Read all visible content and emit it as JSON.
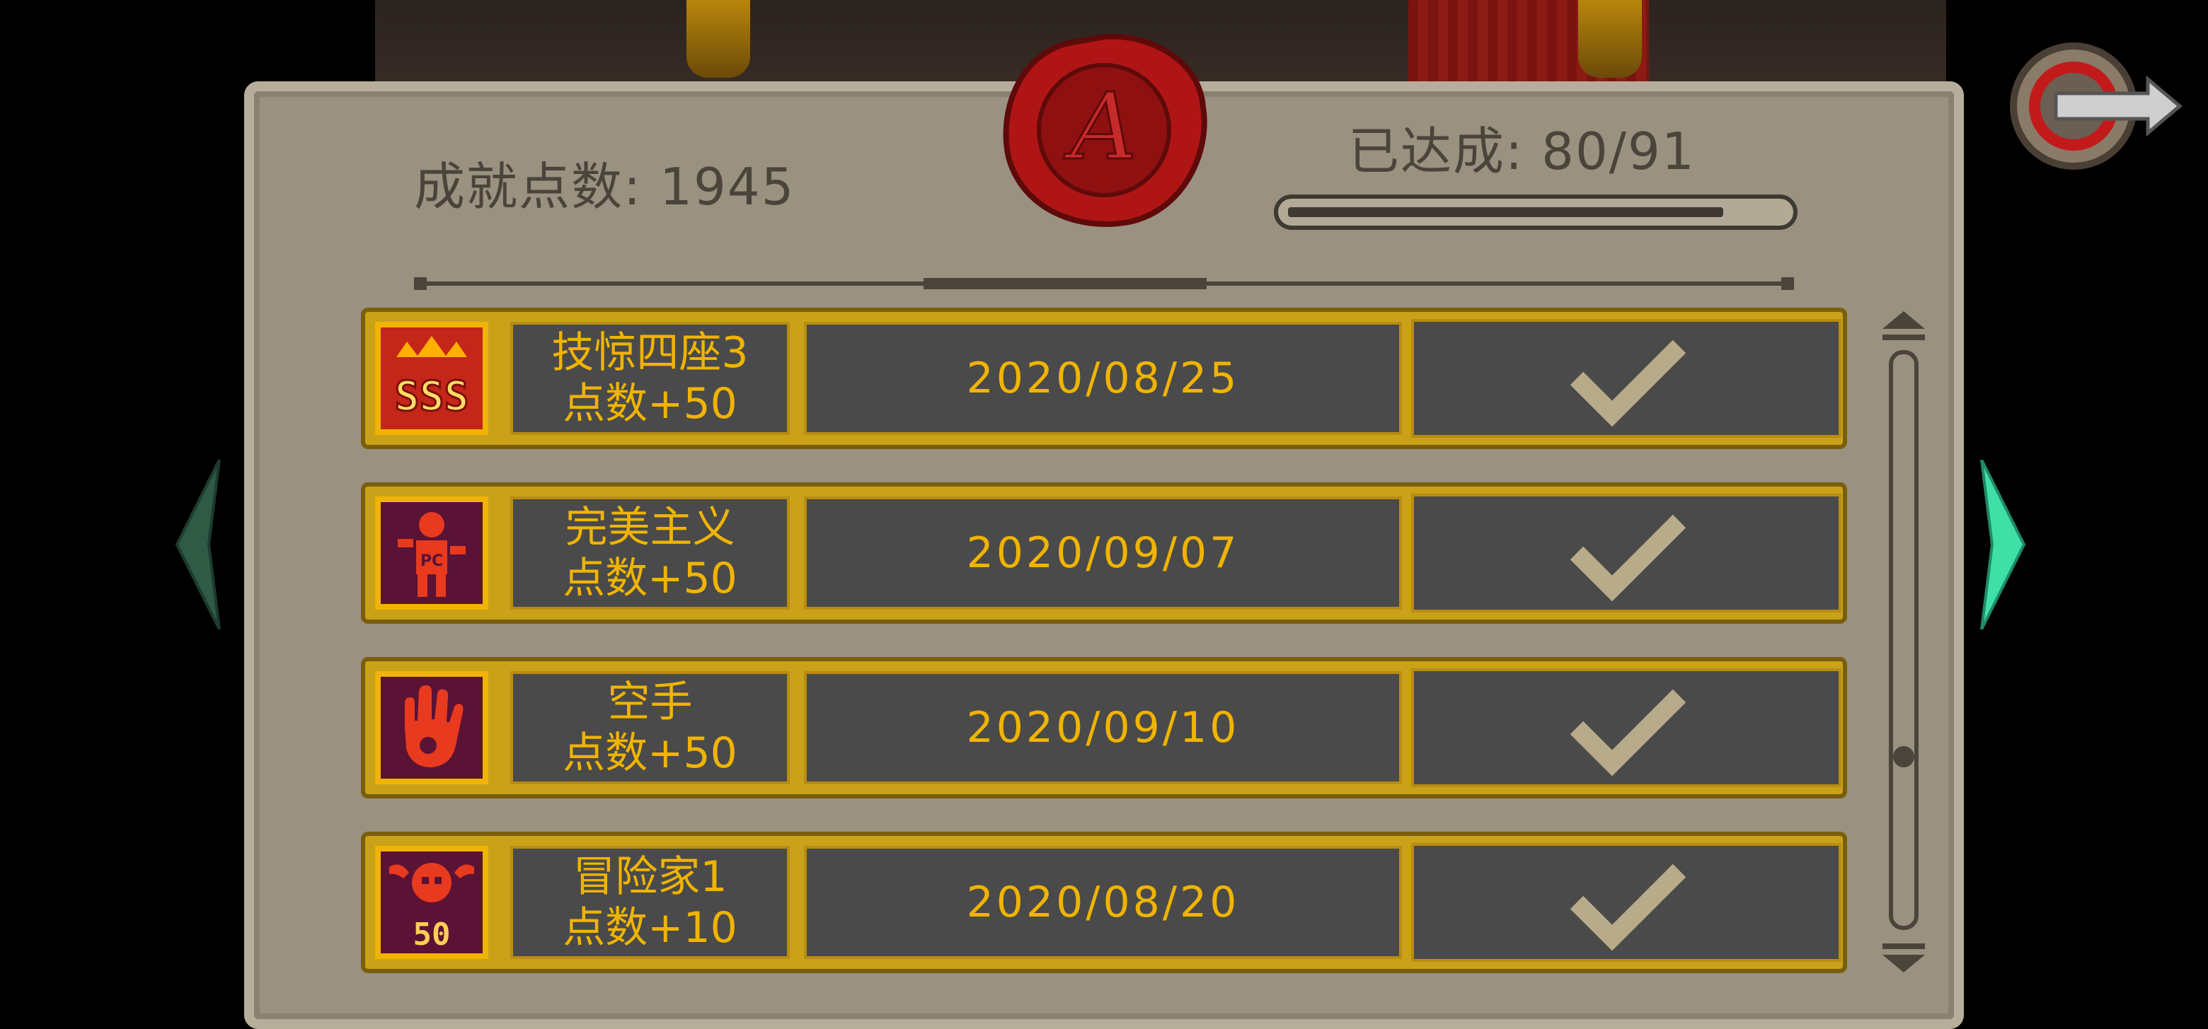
{
  "header": {
    "points_label": "成就点数: 1945",
    "achieved_label": "已达成: 80/91",
    "progress": {
      "achieved": 80,
      "total": 91
    }
  },
  "achievements": [
    {
      "icon": "sss-rank-icon",
      "name": "技惊四座3",
      "points": "点数+50",
      "date": "2020/08/25",
      "completed": true
    },
    {
      "icon": "perfectionist-icon",
      "name": "完美主义",
      "points": "点数+50",
      "date": "2020/09/07",
      "completed": true
    },
    {
      "icon": "empty-hand-icon",
      "name": "空手",
      "points": "点数+50",
      "date": "2020/09/10",
      "completed": true
    },
    {
      "icon": "adventurer-skull-icon",
      "name": "冒险家1",
      "points": "点数+10",
      "date": "2020/08/20",
      "completed": true
    }
  ],
  "colors": {
    "accent_gold": "#f0b400",
    "parchment": "#9a9180",
    "cell_bg": "#4a4a4a",
    "seal_red": "#b01515",
    "arrow_left": "#2f5a46",
    "arrow_right": "#3fe0a8"
  }
}
